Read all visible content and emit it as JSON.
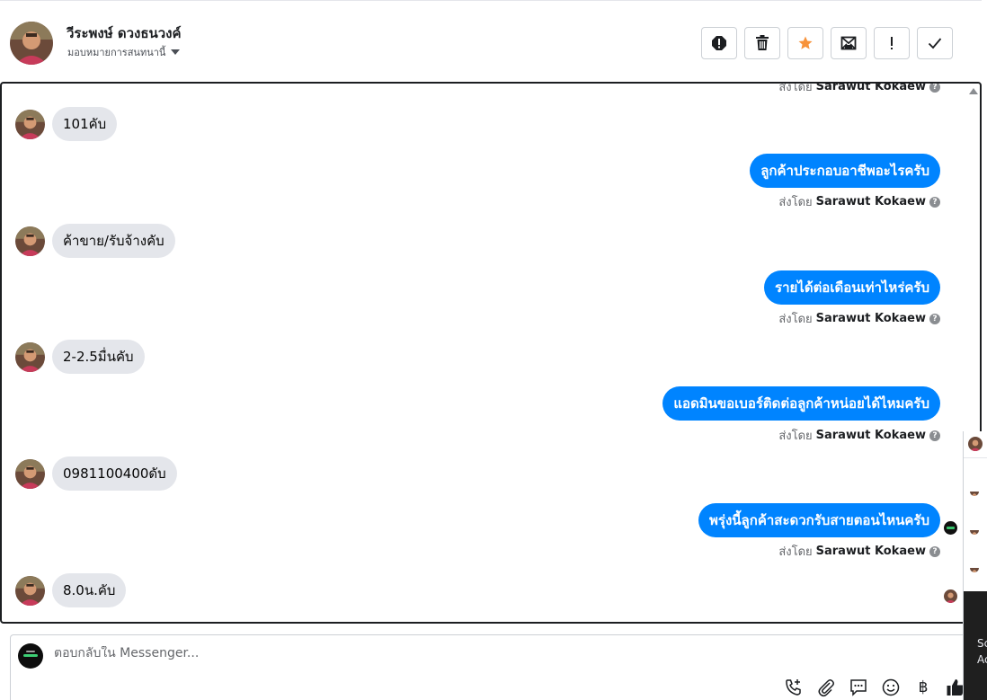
{
  "contact": {
    "name": "วีระพงษ์ ดวงธนวงค์",
    "assign_label": "มอบหมายการสนทนานี้"
  },
  "toolbar": {
    "icons": [
      "report-icon",
      "trash-icon",
      "star-icon",
      "mark-unread-icon",
      "important-icon",
      "done-icon"
    ],
    "star_color": "#f7923a"
  },
  "conversation": {
    "top_partial_sent_by_prefix": "ส่งโดย",
    "top_partial_sent_by_name": "Sarawut Kokaew",
    "messages": [
      {
        "direction": "in",
        "text": "101คับ"
      },
      {
        "direction": "out",
        "text": "ลูกค้าประกอบอาชีพอะไรครับ",
        "sent_by_prefix": "ส่งโดย",
        "sent_by_name": "Sarawut Kokaew"
      },
      {
        "direction": "in",
        "text": "ค้าขาย/รับจ้างคับ"
      },
      {
        "direction": "out",
        "text": "รายได้ต่อเดือนเท่าไหร่ครับ",
        "sent_by_prefix": "ส่งโดย",
        "sent_by_name": "Sarawut Kokaew"
      },
      {
        "direction": "in",
        "text": "2-2.5มื่นคับ"
      },
      {
        "direction": "out",
        "text": "แอดมินขอเบอร์ติดต่อลูกค้าหน่อยได้ไหมครับ",
        "sent_by_prefix": "ส่งโดย",
        "sent_by_name": "Sarawut Kokaew"
      },
      {
        "direction": "in",
        "text": "0981100400ดับ"
      },
      {
        "direction": "out",
        "text": "พรุ่งนี้ลูกค้าสะดวกรับสายตอนไหนครับ",
        "sent_by_prefix": "ส่งโดย",
        "sent_by_name": "Sarawut Kokaew"
      },
      {
        "direction": "in",
        "text": "8.0น.คับ"
      }
    ],
    "outgoing_color": "#0084ff",
    "incoming_color": "#e4e6eb"
  },
  "composer": {
    "placeholder": "ตอบกลับใน Messenger...",
    "tools": [
      "call-add-icon",
      "attachment-icon",
      "saved-reply-icon",
      "emoji-icon",
      "baht-payment-icon",
      "thumbs-up-icon"
    ]
  },
  "side_panel": {
    "line1": "Sc",
    "line2": "Ac"
  }
}
